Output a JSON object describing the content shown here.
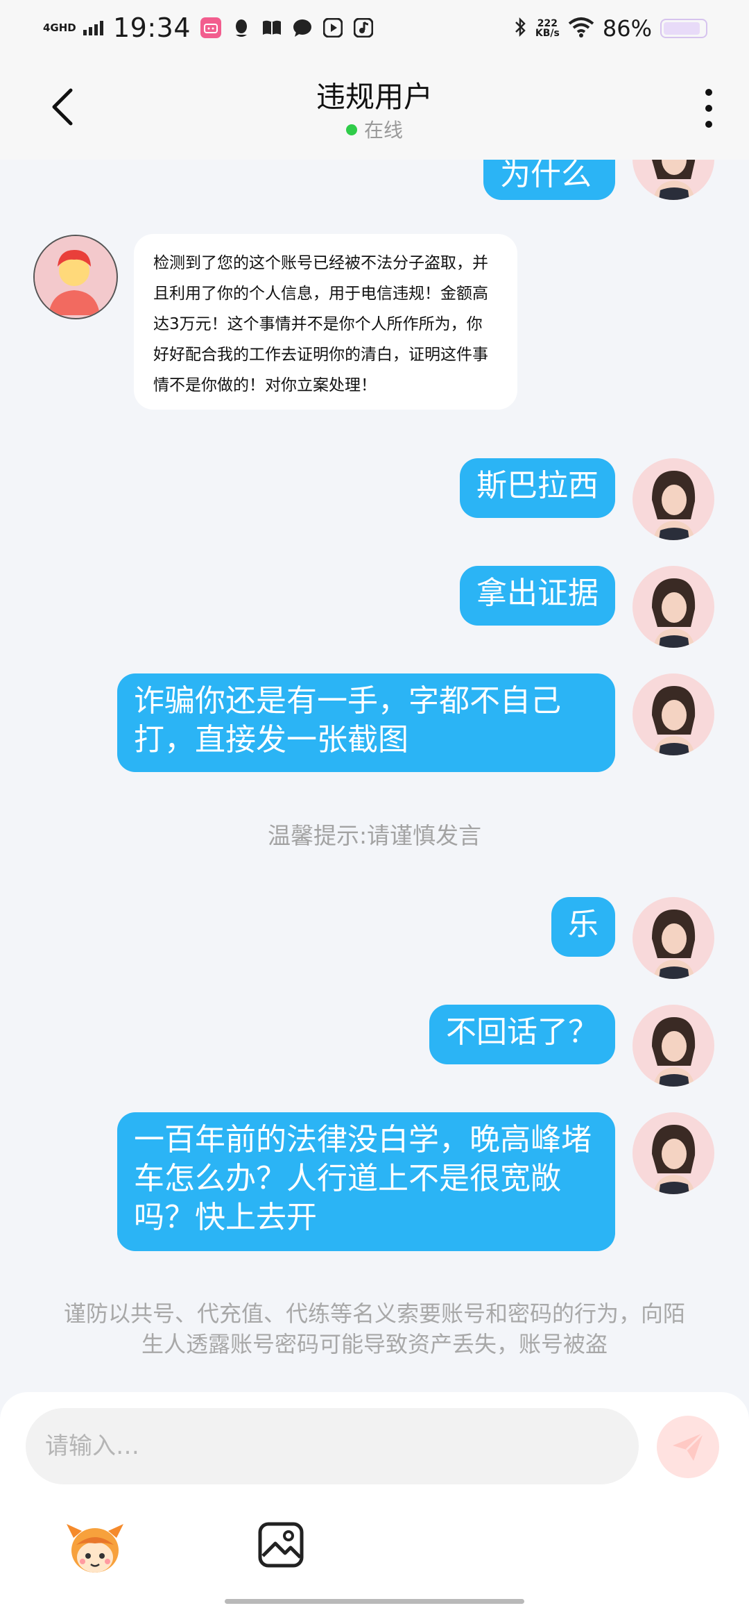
{
  "status_bar": {
    "network": "4GHD",
    "time": "19:34",
    "speed_value": "222",
    "speed_unit": "KB/s",
    "battery": "86%"
  },
  "header": {
    "title": "违规用户",
    "online_status": "在线"
  },
  "messages": [
    {
      "side": "right",
      "text": "为什么"
    },
    {
      "side": "left",
      "text": "检测到了您的这个账号已经被不法分子盗取，并且利用了你的个人信息，用于电信违规！金额高达3万元！这个事情并不是你个人所作所为，你好好配合我的工作去证明你的清白，证明这件事情不是你做的！对你立案处理！"
    },
    {
      "side": "right",
      "text": "斯巴拉西"
    },
    {
      "side": "right",
      "text": "拿出证据"
    },
    {
      "side": "right",
      "text": "诈骗你还是有一手，字都不自己打，直接发一张截图"
    },
    {
      "side": "right",
      "text": "乐"
    },
    {
      "side": "right",
      "text": "不回话了？"
    },
    {
      "side": "right",
      "text": "一百年前的法律没白学，晚高峰堵车怎么办？人行道上不是很宽敞吗？快上去开"
    }
  ],
  "tip": "温馨提示:请谨慎发言",
  "warning": "谨防以共号、代充值、代练等名义索要账号和密码的行为，向陌生人透露账号密码可能导致资产丢失，账号被盗",
  "input": {
    "placeholder": "请输入…"
  },
  "colors": {
    "bubble_blue": "#2bb4f5",
    "online_green": "#2fcc49",
    "send_button_bg": "#ffe2e0"
  },
  "icons": [
    "back-arrow-icon",
    "more-vertical-icon",
    "send-icon",
    "emoji-sticker-icon",
    "image-picture-icon"
  ]
}
